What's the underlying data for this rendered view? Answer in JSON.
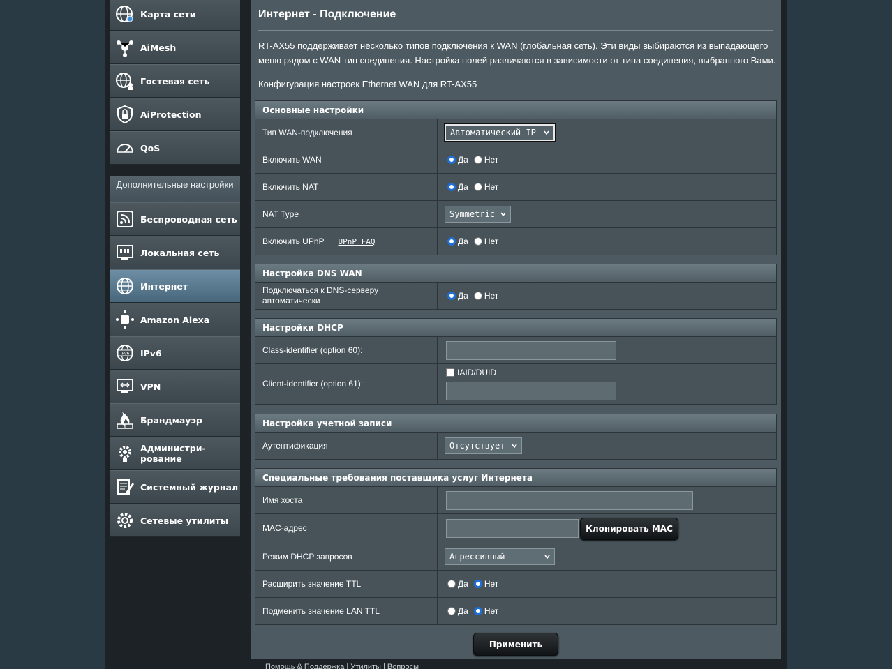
{
  "sidebar": {
    "top_items": [
      {
        "label": "Карта сети",
        "icon": "network-map-icon"
      },
      {
        "label": "AiMesh",
        "icon": "aimesh-icon"
      },
      {
        "label": "Гостевая сеть",
        "icon": "guest-network-icon"
      },
      {
        "label": "AiProtection",
        "icon": "lock-shield-icon"
      },
      {
        "label": "QoS",
        "icon": "gauge-icon"
      }
    ],
    "advanced_header": "Дополнительные настройки",
    "advanced_items": [
      {
        "label": "Беспроводная сеть",
        "icon": "wifi-icon"
      },
      {
        "label": "Локальная сеть",
        "icon": "lan-icon"
      },
      {
        "label": "Интернет",
        "icon": "globe-icon",
        "active": true
      },
      {
        "label": "Amazon Alexa",
        "icon": "alexa-icon"
      },
      {
        "label": "IPv6",
        "icon": "ipv6-globe-icon"
      },
      {
        "label": "VPN",
        "icon": "vpn-icon"
      },
      {
        "label": "Брандмауэр",
        "icon": "firewall-icon"
      },
      {
        "label": "Администри-\nрование",
        "icon": "gear-icon"
      },
      {
        "label": "Системный журнал",
        "icon": "log-icon"
      },
      {
        "label": "Сетевые утилиты",
        "icon": "tools-gear-icon"
      }
    ]
  },
  "main": {
    "title": "Интернет - Подключение",
    "description": "RT-AX55 поддерживает несколько типов подключения к WAN (глобальная сеть). Эти виды выбираются из выпадающего меню рядом с WAN тип соединения. Настройка полей различаются в зависимости от типа соединения, выбранного Вами.",
    "config_line": "Конфигурация настроек Ethernet WAN для RT-AX55"
  },
  "basic": {
    "header": "Основные настройки",
    "wan_type_label": "Тип WAN-подключения",
    "wan_type_value": "Автоматический IP",
    "enable_wan_label": "Включить WAN",
    "enable_nat_label": "Включить NAT",
    "nat_type_label": "NAT Type",
    "nat_type_value": "Symmetric",
    "upnp_label": "Включить UPnP",
    "upnp_faq": "UPnP FAQ"
  },
  "radio": {
    "yes": "Да",
    "no": "Нет"
  },
  "dns": {
    "header": "Настройка DNS WAN",
    "auto_label": "Подключаться к DNS-серверу автоматически"
  },
  "dhcp": {
    "header": "Настройки DHCP",
    "class_id_label": "Class-identifier (option 60):",
    "class_id_value": "",
    "client_id_label": "Client-identifier (option 61):",
    "iaid_label": "IAID/DUID",
    "client_id_value": ""
  },
  "account": {
    "header": "Настройка учетной записи",
    "auth_label": "Аутентификация",
    "auth_value": "Отсутствует"
  },
  "isp": {
    "header": "Специальные требования поставщика услуг Интернета",
    "host_label": "Имя хоста",
    "host_value": "",
    "mac_label": "MAC-адрес",
    "mac_value": "",
    "clone_mac": "Клонировать MAC",
    "dhcp_mode_label": "Режим DHCP запросов",
    "dhcp_mode_value": "Агрессивный",
    "ttl_label": "Расширить значение TTL",
    "lan_ttl_label": "Подменить значение LAN TTL"
  },
  "apply_button": "Применить",
  "footer": "Помощь & Поддержка | Утилиты | Вопросы"
}
